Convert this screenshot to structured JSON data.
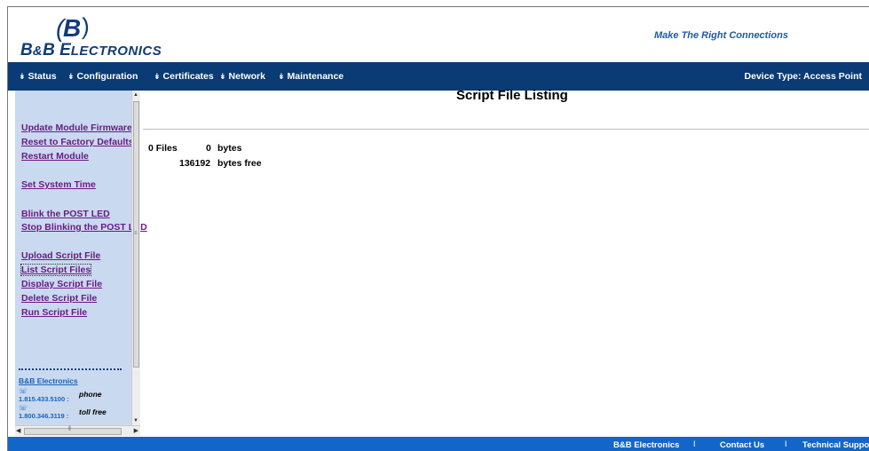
{
  "header": {
    "logo_text_first": "B",
    "logo_amp": "&",
    "logo_text_second": "B E",
    "logo_text_rest": "LECTRONICS",
    "logo_mark": "B",
    "tagline": "Make The Right Connections"
  },
  "nav": {
    "items": [
      {
        "label": "Status",
        "icon": "arrow-icon"
      },
      {
        "label": "Configuration",
        "icon": "arrow-icon"
      },
      {
        "label": "Certificates",
        "icon": "arrow-icon"
      },
      {
        "label": "Network",
        "icon": "arrow-icon"
      },
      {
        "label": "Maintenance",
        "icon": "arrow-icon"
      }
    ],
    "device_type": "Device Type: Access Point"
  },
  "sidebar": {
    "links": [
      "Update Module Firmware",
      "Reset to Factory Defaults",
      "Restart Module",
      "Set System Time",
      "Blink the POST LED",
      "Stop Blinking the POST LED",
      "Upload Script File",
      "List Script Files",
      "Display Script File",
      "Delete Script File",
      "Run Script File"
    ],
    "active": "List Script Files",
    "company": "B&B Electronics",
    "phone": {
      "number": "1.815.433.5100",
      "sep": ":",
      "label": "phone"
    },
    "tollfree": {
      "number": "1.800.346.3119",
      "sep": ":",
      "label": "toll free"
    }
  },
  "main": {
    "title": "Script File Listing",
    "files_count": "0 Files",
    "bytes_value": "0",
    "bytes_label": "bytes",
    "free_value": "136192",
    "free_label": "bytes free"
  },
  "footer": {
    "items": [
      "B&B Electronics",
      "Contact Us",
      "Technical Support"
    ],
    "separator": "I"
  },
  "colors": {
    "nav_bg": "#0b3b74",
    "footer_bg": "#1366c9",
    "sidebar_bg": "#c9d9ef",
    "link": "#6b1b86",
    "brand": "#123a78"
  }
}
